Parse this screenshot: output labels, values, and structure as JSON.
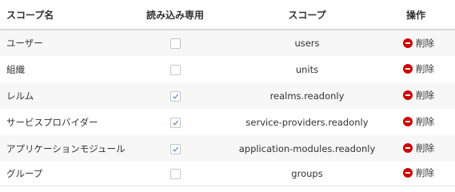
{
  "table": {
    "headers": {
      "name": "スコープ名",
      "readonly": "読み込み専用",
      "scope": "スコープ",
      "actions": "操作"
    },
    "rows": [
      {
        "name": "ユーザー",
        "readonly": false,
        "scope": "users",
        "action": "削除"
      },
      {
        "name": "組織",
        "readonly": false,
        "scope": "units",
        "action": "削除"
      },
      {
        "name": "レルム",
        "readonly": true,
        "scope": "realms.readonly",
        "action": "削除"
      },
      {
        "name": "サービスプロバイダー",
        "readonly": true,
        "scope": "service-providers.readonly",
        "action": "削除"
      },
      {
        "name": "アプリケーションモジュール",
        "readonly": true,
        "scope": "application-modules.readonly",
        "action": "削除"
      },
      {
        "name": "グループ",
        "readonly": false,
        "scope": "groups",
        "action": "削除"
      }
    ]
  },
  "colors": {
    "delete_icon": "#cc0000",
    "check_mark": "#7a9cc2",
    "row_stripe": "#f7f7f7"
  },
  "icons": {
    "delete": "minus-circle-icon",
    "checkbox": "checkbox-icon"
  }
}
